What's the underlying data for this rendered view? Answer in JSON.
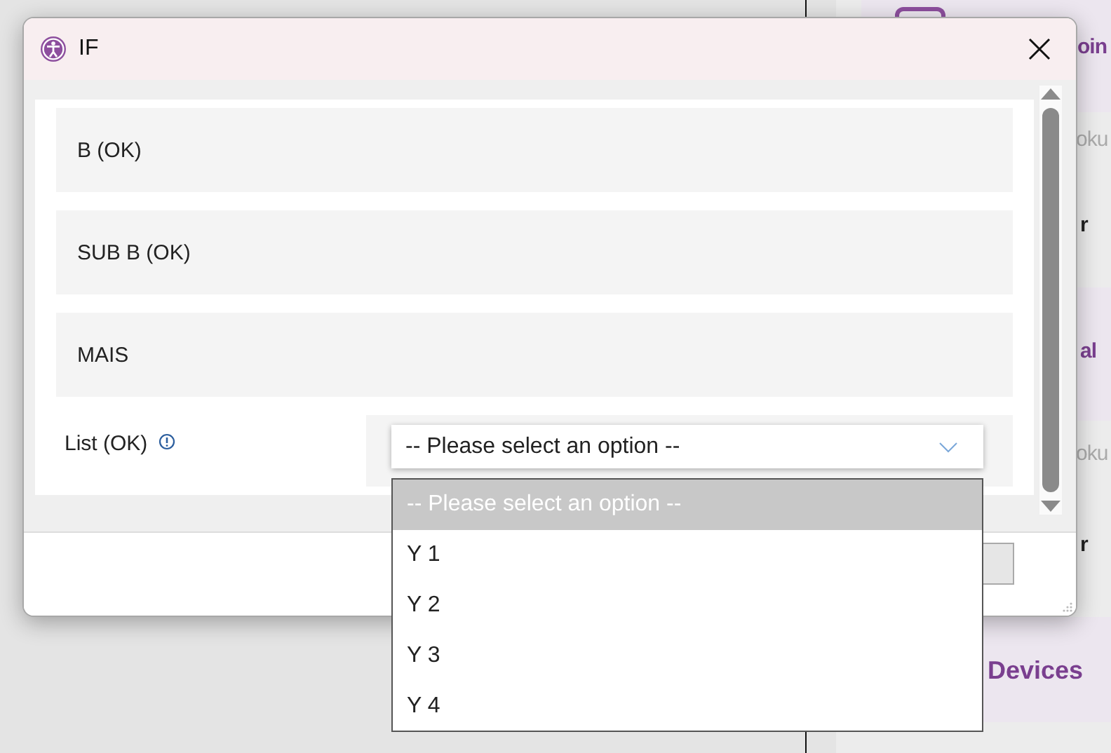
{
  "background": {
    "fragments": [
      {
        "text": "oin",
        "kind": "heading"
      },
      {
        "text": "oku",
        "kind": "muted"
      },
      {
        "text": "r",
        "kind": "strong"
      },
      {
        "text": "al",
        "kind": "heading"
      },
      {
        "text": "oku",
        "kind": "muted"
      },
      {
        "text": "r",
        "kind": "strong"
      },
      {
        "text": "Devices",
        "kind": "heading"
      }
    ]
  },
  "window": {
    "title": "IF"
  },
  "sections": [
    {
      "label": "B (OK)"
    },
    {
      "label": "SUB B (OK)"
    },
    {
      "label": "MAIS"
    }
  ],
  "field": {
    "label": "List (OK)",
    "value": "-- Please select an option --",
    "expanded": true
  },
  "dropdown": {
    "options": [
      {
        "label": "-- Please select an option --",
        "selected": true
      },
      {
        "label": "Y 1",
        "selected": false
      },
      {
        "label": "Y 2",
        "selected": false
      },
      {
        "label": "Y 3",
        "selected": false
      },
      {
        "label": "Y 4",
        "selected": false
      }
    ]
  }
}
